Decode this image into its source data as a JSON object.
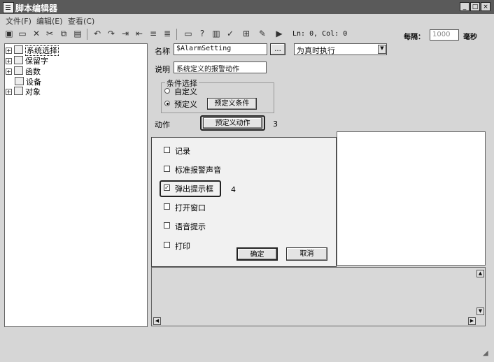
{
  "window": {
    "title": "脚本编辑器",
    "min": "_",
    "max": "□",
    "close": "×"
  },
  "menu": [
    "文件(F)",
    "编辑(E)",
    "查看(C)"
  ],
  "toolbar": {
    "cursor_pos": "Ln: 0, Col: 0",
    "interval_label": "每隔：",
    "interval_value": "1000",
    "interval_unit": "毫秒"
  },
  "tree": {
    "items": [
      "系统选择",
      "保留字",
      "函数",
      "设备",
      "对象"
    ]
  },
  "form": {
    "name_label": "名称",
    "name_value": "$AlarmSetting",
    "browse_label": "...",
    "exec_mode": "为真时执行",
    "desc_label": "说明",
    "desc_value": "系统定义的报警动作",
    "group_title": "条件选择",
    "radio_custom": "自定义",
    "radio_predef": "预定义",
    "predef_cond_button": "预定义条件",
    "action_label": "动作",
    "predef_action_button": "预定义动作",
    "callout_3": "3",
    "callout_4": "4"
  },
  "popup": {
    "options": [
      {
        "label": "记录",
        "checked": false
      },
      {
        "label": "标准报警声音",
        "checked": false
      },
      {
        "label": "弹出提示框",
        "checked": true
      },
      {
        "label": "打开窗口",
        "checked": false
      },
      {
        "label": "语音提示",
        "checked": false
      },
      {
        "label": "打印",
        "checked": false
      }
    ],
    "ok": "确定",
    "cancel": "取消"
  }
}
